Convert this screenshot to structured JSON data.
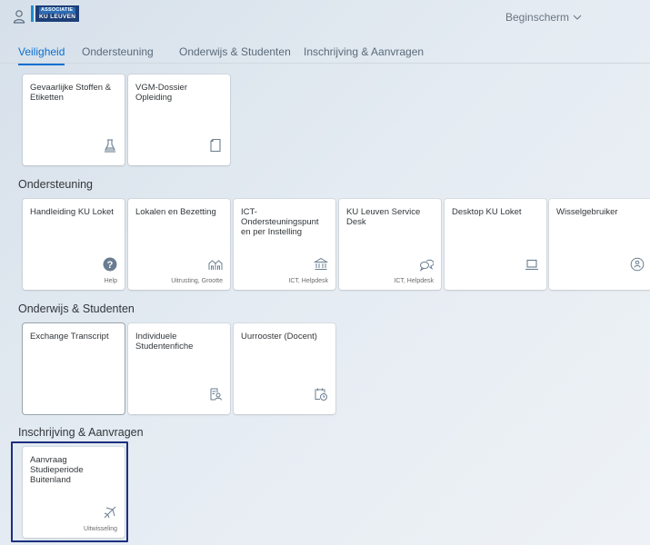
{
  "header": {
    "user_icon": "person-icon",
    "logo": {
      "line1": "ASSOCIATIE",
      "line2": "KU LEUVEN"
    },
    "home_label": "Beginscherm"
  },
  "tabs": [
    {
      "label": "Veiligheid",
      "active": true
    },
    {
      "label": "Ondersteuning",
      "active": false
    },
    {
      "label": "Onderwijs & Studenten",
      "active": false
    },
    {
      "label": "Inschrijving & Aanvragen",
      "active": false
    }
  ],
  "sections": {
    "veiligheid": {
      "tiles": [
        {
          "title": "Gevaarlijke Stoffen & Etiketten",
          "icon": "flask-icon",
          "footer": ""
        },
        {
          "title": "VGM-Dossier Opleiding",
          "icon": "document-icon",
          "footer": ""
        }
      ]
    },
    "ondersteuning": {
      "title": "Ondersteuning",
      "tiles": [
        {
          "title": "Handleiding KU Loket",
          "icon": "help-icon",
          "footer": "Help"
        },
        {
          "title": "Lokalen en Bezetting",
          "icon": "building-icon",
          "footer": "Uitrusting, Grootte"
        },
        {
          "title": "ICT-Ondersteuningspunt en per Instelling",
          "icon": "institution-icon",
          "footer": "ICT, Helpdesk"
        },
        {
          "title": "KU Leuven Service Desk",
          "icon": "conversation-icon",
          "footer": "ICT, Helpdesk"
        },
        {
          "title": "Desktop KU Loket",
          "icon": "laptop-icon",
          "footer": ""
        },
        {
          "title": "Wisselgebruiker",
          "icon": "switch-user-icon",
          "footer": ""
        }
      ]
    },
    "onderwijs": {
      "title": "Onderwijs & Studenten",
      "tiles": [
        {
          "title": "Exchange Transcript",
          "icon": "",
          "footer": ""
        },
        {
          "title": "Individuele Studentenfiche",
          "icon": "student-card-icon",
          "footer": ""
        },
        {
          "title": "Uurrooster (Docent)",
          "icon": "schedule-icon",
          "footer": ""
        }
      ]
    },
    "inschrijving": {
      "title": "Inschrijving & Aanvragen",
      "tiles": [
        {
          "title": "Aanvraag Studieperiode Buitenland",
          "icon": "flight-icon",
          "footer": "Uitwisseling"
        }
      ]
    }
  },
  "colors": {
    "accent": "#0a6ed1",
    "focus_frame": "#1c2f80",
    "logo_blue": "#1d3f78"
  }
}
